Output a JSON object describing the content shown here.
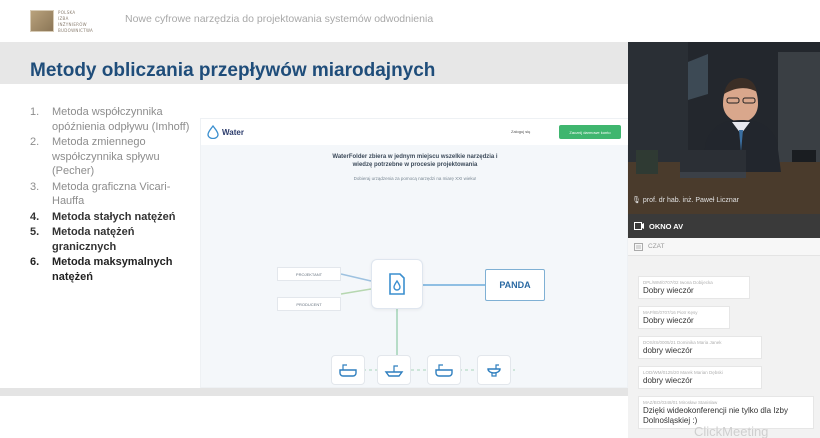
{
  "header": {
    "logo_lines": [
      "POLSKA",
      "IZBA",
      "INŻYNIERÓW",
      "BUDOWNICTWA"
    ],
    "title": "Nowe cyfrowe narzędzia do projektowania systemów odwodnienia"
  },
  "slide": {
    "title": "Metody obliczania przepływów miarodajnych",
    "methods": [
      {
        "num": "1.",
        "label": "Metoda współczynnika opóźnienia odpływu (Imhoff)"
      },
      {
        "num": "2.",
        "label": "Metoda zmiennego współczynnika spływu (Pecher)"
      },
      {
        "num": "3.",
        "label": "Metoda graficzna Vicari-Hauffa"
      },
      {
        "num": "4.",
        "label": "Metoda stałych natężeń"
      },
      {
        "num": "5.",
        "label": "Metoda natężeń granicznych"
      },
      {
        "num": "6.",
        "label": "Metoda maksymalnych natężeń"
      }
    ],
    "website": {
      "logo": "Water",
      "nav_link": "Zaloguj się",
      "cta": "Zacznij darmowe konto",
      "headline_1": "WaterFolder zbiera w jednym miejscu wszelkie narzędzia i",
      "headline_2": "wiedzę potrzebne w procesie projektowania",
      "subline": "Dobieraj urządzenia za pomocą narzędzi na miarę XXI wieku!",
      "tag_top": "PROJEKTANT",
      "tag_bottom": "PRODUCENT",
      "panda": "PANDA"
    }
  },
  "panel": {
    "speaker": "prof. dr hab. inż. Paweł Licznar",
    "av_label": "OKNO AV",
    "chat_label": "CZAT",
    "messages": [
      {
        "author": "DPL/WM/0707/02 Iwona Dobijecka",
        "text": "Dobry wieczór"
      },
      {
        "author": "MAP/IE/0707/16 Piotr Kęsy",
        "text": "Dobry wieczór"
      },
      {
        "author": "DOS/IS/0005/21 Dominika Maria Janek",
        "text": "dobry wieczór"
      },
      {
        "author": "LOD/WM/0125/20 Marek Marian Dębski",
        "text": "dobry wieczór"
      },
      {
        "author": "MAZ/BO/0348/01 Mirosław Stanisław",
        "text": "Dzięki wideokonferencji nie tylko dla Izby Dolnośląskiej :)"
      }
    ],
    "watermark": "ClickMeeting"
  },
  "colors": {
    "title_blue": "#1f4d7a",
    "cta_green": "#3fb66f",
    "panda_blue": "#2b6aa3",
    "av_bar": "#3a3a3a"
  }
}
